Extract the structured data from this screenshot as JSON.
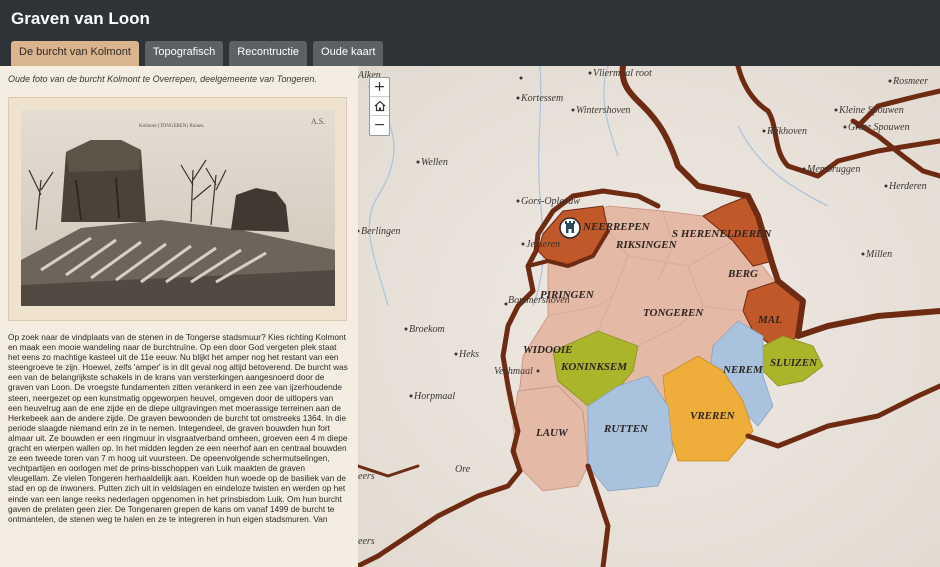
{
  "header": {
    "title": "Graven van Loon"
  },
  "tabs": [
    {
      "label": "De burcht van Kolmont",
      "active": true
    },
    {
      "label": "Topografisch",
      "active": false
    },
    {
      "label": "Recontructie",
      "active": false
    },
    {
      "label": "Oude kaart",
      "active": false
    }
  ],
  "sidepanel": {
    "caption": "Oude foto van de burcht Kolmont te Overrepen, deelgemeente van Tongeren.",
    "photo": {
      "label": "Kolmont (TONGEREN) Ruines.",
      "initials": "A.S."
    },
    "body": "Op zoek naar de vindplaats van de stenen in de Tongerse stadsmuur? Kies richting Kolmont en maak een mooie wandeling naar de burchtruïne. Op een door God vergeten plek staat het eens zo machtige kasteel uit de 11e eeuw. Nu blijkt het amper nog het restant van een steengroeve te zijn. Hoewel, zelfs 'amper' is in dit geval nog altijd betoverend. De burcht was een van de belangrijkste schakels in de krans van versterkingen aangesnoerd door de graven van Loon. De vroegste fundamenten zitten verankerd in een zee van ijzerhoudende steen, neergezet op een kunstmatig opgeworpen heuvel, omgeven door de uitlopers van een heuvelrug aan de ene zijde en de diepe uitgravingen met moerassige terreinen aan de Herkebeek aan de andere zijde. De graven bewoonden de burcht tot omstreeks 1364. In die periode slaagde niemand erin ze in te nemen. Integendeel, de graven bouwden hun fort almaar uit. Ze bouwden er een ringmuur in visgraatverband omheen, groeven een 4 m diepe gracht en wierpen wallen op. In het midden legden ze een neerhof aan en centraal bouwden ze een tweede toren van 7 m hoog uit vuursteen. De opeenvolgende schermutselingen, vechtpartijen en oorlogen met de prins-bisschoppen van Luik maakten de graven vleugellam. Ze vielen Tongeren herhaaldelijk aan. Koelden hun woede op de basiliek van de stad en op de inwoners. Putten zich uit in veldslagen en eindeloze twisten en werden op het einde van een lange reeks nederlagen opgenomen in het prinsbisdom Luik. Om hun burcht gaven de prelaten geen zier. De Tongenaren grepen de kans om vanaf 1499 de burcht te ontmantelen, de stenen weg te halen en ze te integreren in hun eigen stadsmuren. Van"
  },
  "map": {
    "zoom_in": "+",
    "zoom_out": "−",
    "home_icon": "home-icon",
    "marker_icon": "castle-marker-icon",
    "colors": {
      "background": "#e9e3dc",
      "border": "#6e2b12",
      "tongeren_zone": "#e4b9a6",
      "highlight_orange": "#c0582a",
      "koninksem": "#aab52a",
      "sluizen": "#aab52a",
      "rutten": "#a9c3df",
      "nerem": "#a9c3df",
      "vreren": "#efae3a",
      "water": "#a9c3df"
    },
    "region_labels": {
      "neerrepen": "NEERREPEN",
      "riksingen": "RIKSINGEN",
      "henis": "S HERENELDEREN",
      "berg": "BERG",
      "piringen": "PIRINGEN",
      "tongeren": "TONGEREN",
      "mal": "MAL",
      "widooie": "WIDOOIE",
      "koninksem": "KONINKSEM",
      "nerem": "NEREM",
      "sluizen": "SLUIZEN",
      "vreren": "VREREN",
      "rutten": "RUTTEN",
      "lauw": "LAUW"
    },
    "places": {
      "alken": "Alken",
      "vliermaal": "Vliermaal root",
      "kortessem": "Kortessem",
      "wintershoven": "Wintershoven",
      "rosmeer": "Rosmeer",
      "kleine_spouwen": "Kleine Spouwen",
      "grote_spouwen": "Grote Spouwen",
      "rijkhoven": "Rijkhoven",
      "wellen": "Wellen",
      "membruggen": "Membruggen",
      "herderen": "Herderen",
      "gors_opleeuw": "Gors-Opleeuw",
      "berlingen": "Berlingen",
      "jesseren": "Jesseren",
      "millen": "Millen",
      "bommershoven": "Bommershoven",
      "broekom": "Broekom",
      "heks": "Heks",
      "vechmaal": "Vechmaal",
      "horpmaal": "Horpmaal",
      "ore": "Ore",
      "eers": "eers",
      "eers2": "eers"
    }
  }
}
